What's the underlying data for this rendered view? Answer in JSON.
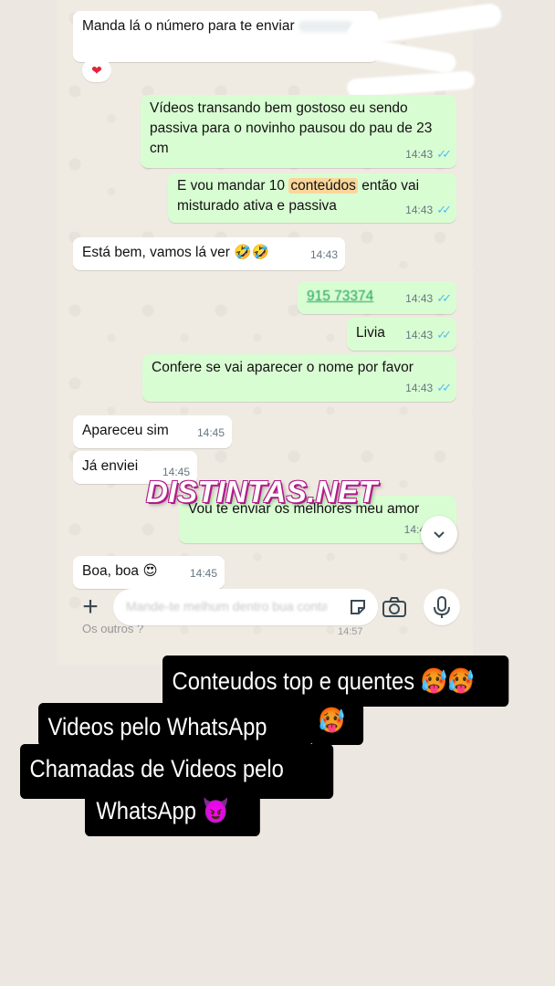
{
  "messages": [
    {
      "id": "m1",
      "dir": "in",
      "text": "Manda lá o número para te enviar"
    },
    {
      "id": "m2",
      "dir": "out",
      "text": "Vídeos transando bem gostoso eu sendo passiva para o novinho pausou do pau de 23 cm",
      "time": "14:43"
    },
    {
      "id": "m3",
      "dir": "out",
      "text_before": "E vou mandar 10 ",
      "text_highlight": "conteúdos",
      "text_after": " então vai misturado ativa e passiva",
      "time": "14:43"
    },
    {
      "id": "m4",
      "dir": "in",
      "text": "Está bem, vamos lá ver 🤣🤣",
      "time": "14:43"
    },
    {
      "id": "m5",
      "dir": "out",
      "text": "915 73374",
      "time": "14:43"
    },
    {
      "id": "m6",
      "dir": "out",
      "text": "Livia",
      "time": "14:43"
    },
    {
      "id": "m7",
      "dir": "out",
      "text": "Confere se vai aparecer o nome por favor",
      "time": "14:43"
    },
    {
      "id": "m8",
      "dir": "in",
      "text": "Apareceu sim",
      "time": "14:45"
    },
    {
      "id": "m9",
      "dir": "in",
      "text": "Já enviei",
      "time": "14:45"
    },
    {
      "id": "m10",
      "dir": "out",
      "text": "Vou te enviar os melhores meu amor",
      "time": "14:4"
    },
    {
      "id": "m11",
      "dir": "in",
      "text": "Boa, boa 😍",
      "time": "14:45"
    }
  ],
  "reaction": "❤",
  "watermark": "DISTINTAS.NET",
  "faded_text": {
    "left": "Os outros ?",
    "time": "14:57"
  },
  "composer": {
    "placeholder": "Mande-te melhum dentro bua conta"
  },
  "icons": [
    "plus-icon",
    "sticker-icon",
    "camera-icon",
    "microphone-icon",
    "chevron-down-icon",
    "double-check-icon"
  ],
  "captions": [
    {
      "text": "Conteudos top e quentes 🥵🥵"
    },
    {
      "text": "🥵"
    },
    {
      "text": "Videos pelo WhatsApp"
    },
    {
      "text": "Chamadas de Videos pelo"
    },
    {
      "text": "WhatsApp 😈"
    }
  ],
  "colors": {
    "incoming": "#ffffff",
    "outgoing": "#d9fdd3",
    "ticks": "#53bdeb",
    "caption_bg": "#000000",
    "watermark_outline": "#b31a8a"
  }
}
